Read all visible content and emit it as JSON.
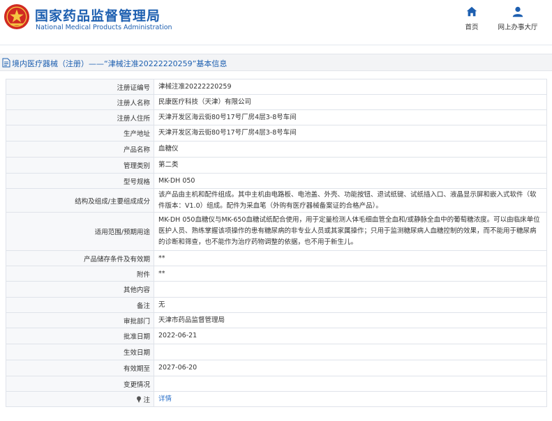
{
  "header": {
    "brand_cn": "国家药品监督管理局",
    "brand_en": "National Medical Products Administration",
    "nav": [
      {
        "label": "首页",
        "icon": "home-icon"
      },
      {
        "label": "网上办事大厅",
        "icon": "user-icon"
      }
    ]
  },
  "page_title": "境内医疗器械（注册）——“津械注准20222220259”基本信息",
  "colors": {
    "brand_blue": "#1d5fb0",
    "logo_red": "#d12a22",
    "link_blue": "#2a6fc9"
  },
  "rows": [
    {
      "label": "注册证编号",
      "value": "津械注准20222220259"
    },
    {
      "label": "注册人名称",
      "value": "民康医疗科技（天津）有限公司"
    },
    {
      "label": "注册人住所",
      "value": "天津开发区海云街80号17号厂房4层3-8号车间"
    },
    {
      "label": "生产地址",
      "value": "天津开发区海云街80号17号厂房4层3-8号车间"
    },
    {
      "label": "产品名称",
      "value": "血糖仪"
    },
    {
      "label": "管理类别",
      "value": "第二类"
    },
    {
      "label": "型号规格",
      "value": "MK-DH 050"
    },
    {
      "label": "结构及组成/主要组成成分",
      "value": "该产品由主机和配件组成。其中主机由电路板、电池盖、外壳、功能按钮、退试纸键、试纸插入口、液晶显示屏和嵌入式软件（软件版本：V1.0）组成。配件为采血笔（外购有医疗器械备案证的合格产品）。"
    },
    {
      "label": "适用范围/预期用途",
      "value": "MK-DH 050血糖仪与MK-650血糖试纸配合使用，用于定量检测人体毛细血管全血和/或静脉全血中的葡萄糖浓度。可以由临床单位医护人员、熟练掌握该项操作的患有糖尿病的非专业人员或其家属操作；只用于监测糖尿病人血糖控制的效果，而不能用于糖尿病的诊断和筛查，也不能作为治疗药物调整的依据，也不用于新生儿。"
    },
    {
      "label": "产品储存条件及有效期",
      "value": "**"
    },
    {
      "label": "附件",
      "value": "**"
    },
    {
      "label": "其他内容",
      "value": ""
    },
    {
      "label": "备注",
      "value": "无"
    },
    {
      "label": "审批部门",
      "value": "天津市药品监督管理局"
    },
    {
      "label": "批准日期",
      "value": "2022-06-21"
    },
    {
      "label": "生效日期",
      "value": ""
    },
    {
      "label": "有效期至",
      "value": "2027-06-20"
    },
    {
      "label": "变更情况",
      "value": ""
    }
  ],
  "note_row": {
    "label": "注",
    "value": "详情"
  }
}
